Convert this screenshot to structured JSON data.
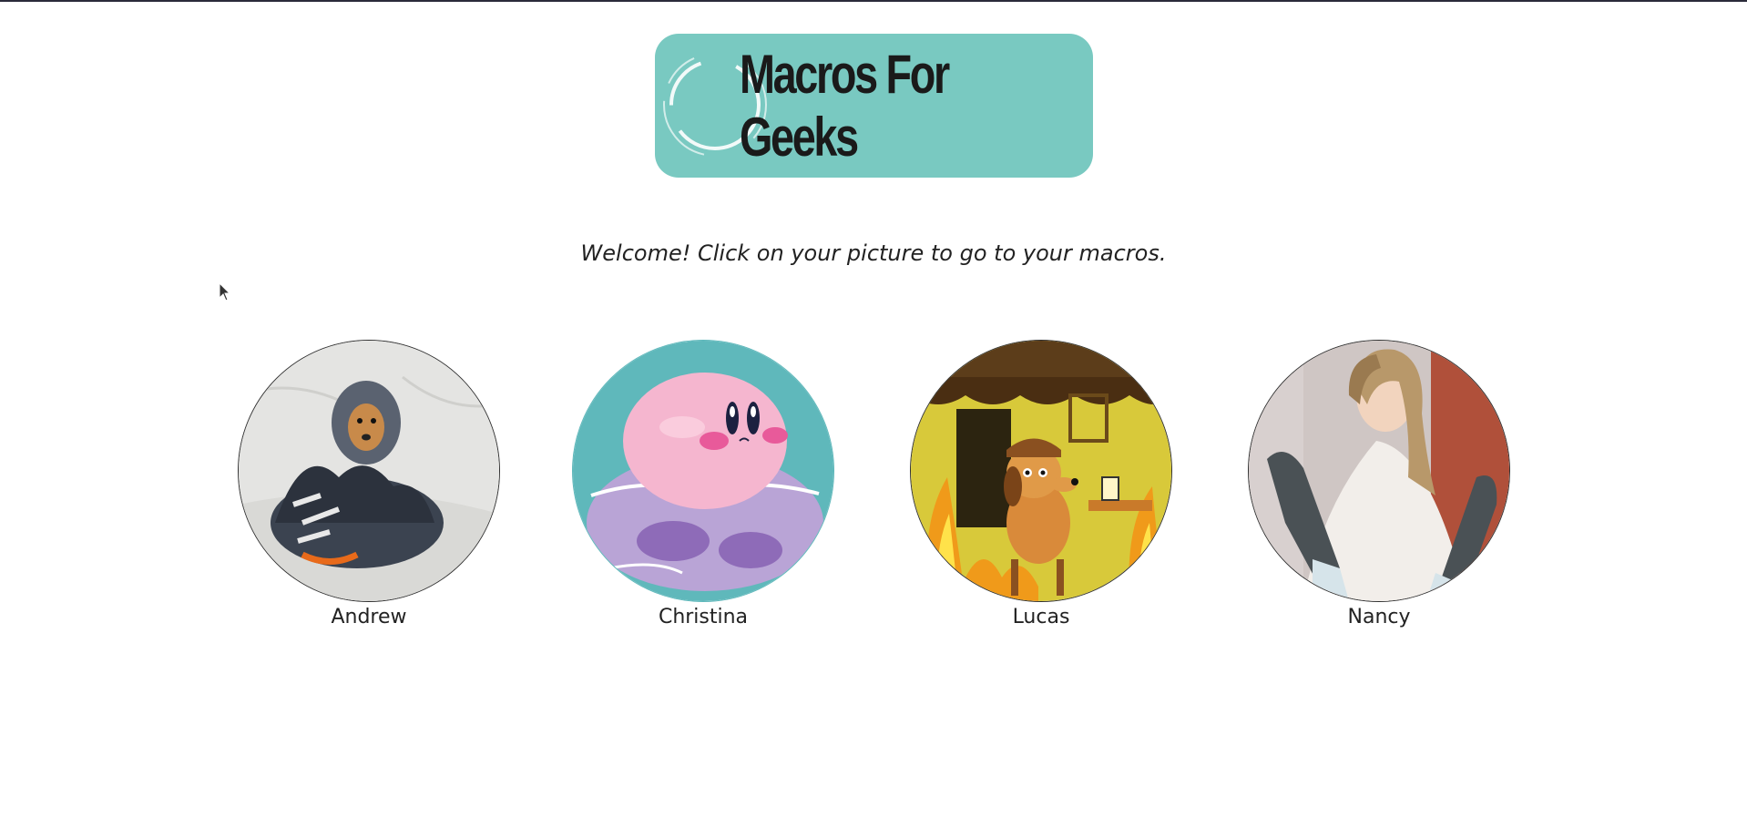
{
  "logo": {
    "text": "Macros For Geeks",
    "background": "#79c9c1"
  },
  "welcome_text": "Welcome! Click on your picture to go to your macros.",
  "users": [
    {
      "name": "Andrew",
      "picture": "dog-in-blanket-photo"
    },
    {
      "name": "Christina",
      "picture": "kirby-in-water-illustration"
    },
    {
      "name": "Lucas",
      "picture": "this-is-fine-dog-illustration"
    },
    {
      "name": "Nancy",
      "picture": "person-sitting-photo"
    }
  ],
  "colors": {
    "accent": "#79c9c1",
    "text": "#222222",
    "page_background": "#ffffff"
  }
}
